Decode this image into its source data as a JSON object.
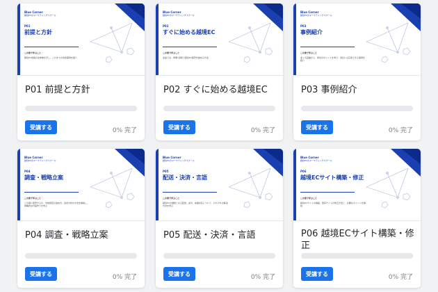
{
  "courses": [
    {
      "code": "P01",
      "thumb_title": "前提と方針",
      "title": "P01 前提と方針",
      "desc": "越境EC成長の全体像を示し、これまでの支援事例を紹介"
    },
    {
      "code": "P02",
      "thumb_title": "すぐに始める越境EC",
      "title": "P02 すぐに始める越境EC",
      "desc": "最速では、準備1週間で越境EC販売を始める方法"
    },
    {
      "code": "P03",
      "thumb_title": "事例紹介",
      "title": "P03 事例紹介",
      "desc": "多くの実績から、成功のポイントを学び、自社にも応用できる事例を紹介"
    },
    {
      "code": "P04",
      "thumb_title": "調査・戦略立案",
      "title": "P04 調査・戦略立案",
      "desc": "どの国に販売するか、市場調査の進め方、競合分析の方法を解説し、戦略的な計画作りを学ぶ"
    },
    {
      "code": "P05",
      "thumb_title": "配送・決済・言語",
      "title": "P05 配送・決済・言語",
      "desc": "越境ECの課題となる配送、決済、言語対応について、それぞれの解決方法を学ぶ"
    },
    {
      "code": "P06",
      "thumb_title": "越境ECサイト構築・修正",
      "title": "P06 越境ECサイト構築・修正",
      "desc": "越境ECサイトの構築、既存サイトの修正方法と、必要なポイントを解説"
    }
  ],
  "thumb": {
    "brand": "Blue Corner",
    "brand_sub": "越境ECのマーケティングスクール",
    "section_label": "この章で学ぶこと"
  },
  "labels": {
    "enroll": "受講する",
    "progress_text": "0% 完了"
  },
  "progress": [
    0,
    0,
    0,
    0,
    0,
    0
  ],
  "colors": {
    "brand": "#1a3fb0",
    "button": "#1a73e8"
  }
}
